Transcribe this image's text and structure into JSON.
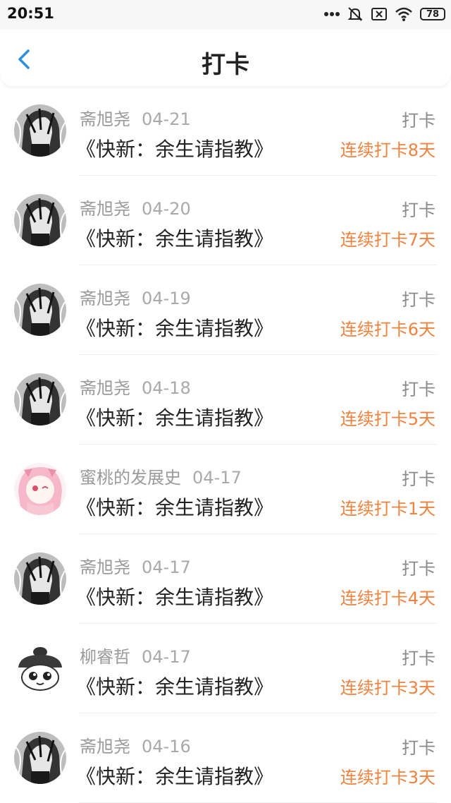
{
  "status": {
    "time": "20:51",
    "battery": "78"
  },
  "header": {
    "title": "打卡"
  },
  "records": [
    {
      "user": "斋旭尧",
      "date": "04-21",
      "book": "《快新：余生请指教》",
      "type": "打卡",
      "streak": "连续打卡8天",
      "avatar": "manga"
    },
    {
      "user": "斋旭尧",
      "date": "04-20",
      "book": "《快新：余生请指教》",
      "type": "打卡",
      "streak": "连续打卡7天",
      "avatar": "manga"
    },
    {
      "user": "斋旭尧",
      "date": "04-19",
      "book": "《快新：余生请指教》",
      "type": "打卡",
      "streak": "连续打卡6天",
      "avatar": "manga"
    },
    {
      "user": "斋旭尧",
      "date": "04-18",
      "book": "《快新：余生请指教》",
      "type": "打卡",
      "streak": "连续打卡5天",
      "avatar": "manga"
    },
    {
      "user": "蜜桃的发展史",
      "date": "04-17",
      "book": "《快新：余生请指教》",
      "type": "打卡",
      "streak": "连续打卡1天",
      "avatar": "pink"
    },
    {
      "user": "斋旭尧",
      "date": "04-17",
      "book": "《快新：余生请指教》",
      "type": "打卡",
      "streak": "连续打卡4天",
      "avatar": "manga"
    },
    {
      "user": "柳睿哲",
      "date": "04-17",
      "book": "《快新：余生请指教》",
      "type": "打卡",
      "streak": "连续打卡3天",
      "avatar": "cartoon"
    },
    {
      "user": "斋旭尧",
      "date": "04-16",
      "book": "《快新：余生请指教》",
      "type": "打卡",
      "streak": "连续打卡3天",
      "avatar": "manga"
    }
  ]
}
